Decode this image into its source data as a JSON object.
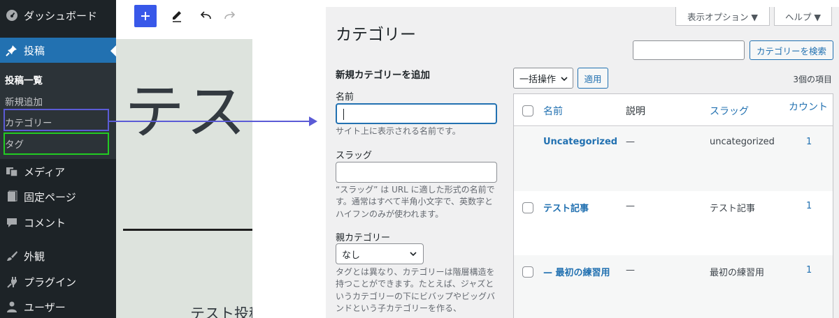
{
  "sidebar": {
    "items": [
      {
        "label": "ダッシュボード",
        "icon": "dashboard-icon"
      },
      {
        "label": "投稿",
        "icon": "pin-icon"
      },
      {
        "label": "メディア",
        "icon": "media-icon"
      },
      {
        "label": "固定ページ",
        "icon": "page-icon"
      },
      {
        "label": "コメント",
        "icon": "comment-icon"
      },
      {
        "label": "外観",
        "icon": "brush-icon"
      },
      {
        "label": "プラグイン",
        "icon": "plugin-icon"
      },
      {
        "label": "ユーザー",
        "icon": "users-icon"
      }
    ],
    "submenu": [
      "投稿一覧",
      "新規追加",
      "カテゴリー",
      "タグ"
    ]
  },
  "editor": {
    "big_title": "テスト",
    "small_title": "テスト投稿"
  },
  "annotation": {
    "category_box_color": "#5b5bd6",
    "tag_box_color": "#22cc22",
    "arrow_color": "#5b5bd6"
  },
  "category_screen": {
    "screen_options_label": "表示オプション ▼",
    "help_label": "ヘルプ ▼",
    "page_title": "カテゴリー",
    "search_button": "カテゴリーを検索",
    "form": {
      "heading": "新規カテゴリーを追加",
      "name_label": "名前",
      "name_help": "サイト上に表示される名前です。",
      "slug_label": "スラッグ",
      "slug_help": "“スラッグ” は URL に適した形式の名前です。通常はすべて半角小文字で、英数字とハイフンのみが使われます。",
      "parent_label": "親カテゴリー",
      "parent_value": "なし",
      "parent_help": "タグとは異なり、カテゴリーは階層構造を持つことができます。たとえば、ジャズというカテゴリーの下にビバップやビッグバンドという子カテゴリーを作る、"
    },
    "bulk_action": "一括操作",
    "apply_button": "適用",
    "item_count": "3個の項目",
    "table": {
      "headers": [
        "名前",
        "説明",
        "スラッグ",
        "カウント"
      ],
      "rows": [
        {
          "name": "Uncategorized",
          "description": "—",
          "slug": "uncategorized",
          "count": "1"
        },
        {
          "name": "テスト記事",
          "description": "—",
          "slug": "テスト記事",
          "count": "1"
        },
        {
          "name": "— 最初の練習用",
          "description": "—",
          "slug": "最初の練習用",
          "count": "1"
        }
      ]
    }
  }
}
